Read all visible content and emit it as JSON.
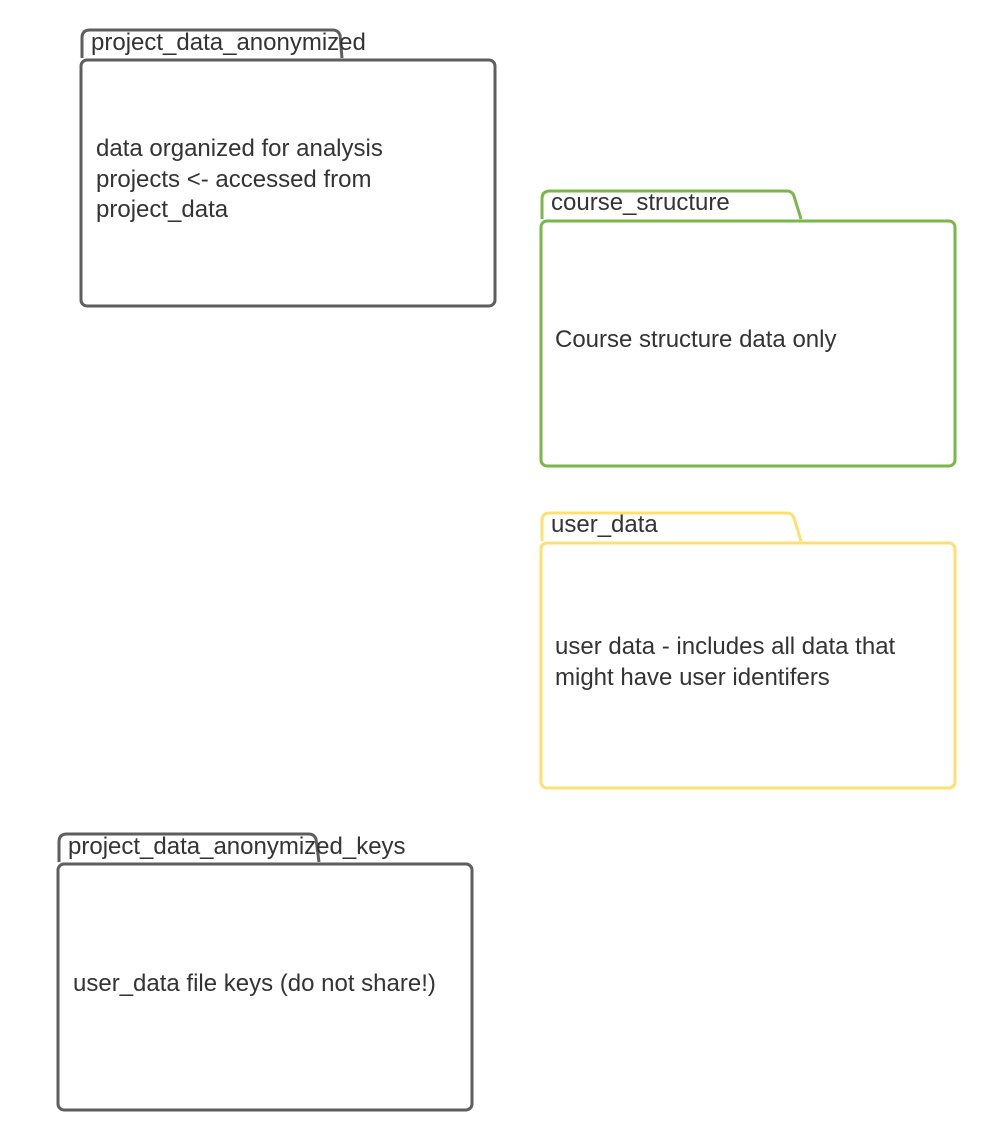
{
  "colors": {
    "gray": "#5e5e5e",
    "green": "#7ab648",
    "yellow": "#ffdf71",
    "text": "#333333"
  },
  "folders": [
    {
      "id": "project-data-anonymized",
      "tab_label": "project_data_anonymized",
      "body_lines": [
        "data organized for analysis",
        "projects <- accessed from",
        "project_data"
      ],
      "color_key": "gray"
    },
    {
      "id": "course-structure",
      "tab_label": "course_structure",
      "body_lines": [
        "Course structure data only"
      ],
      "color_key": "green"
    },
    {
      "id": "user-data",
      "tab_label": "user_data",
      "body_lines": [
        "user data - includes all data that",
        "might have user identifers"
      ],
      "color_key": "yellow"
    },
    {
      "id": "project-data-anonymized-keys",
      "tab_label": "project_data_anonymized_keys",
      "body_lines": [
        "user_data file keys (do not share!)"
      ],
      "color_key": "gray"
    }
  ]
}
